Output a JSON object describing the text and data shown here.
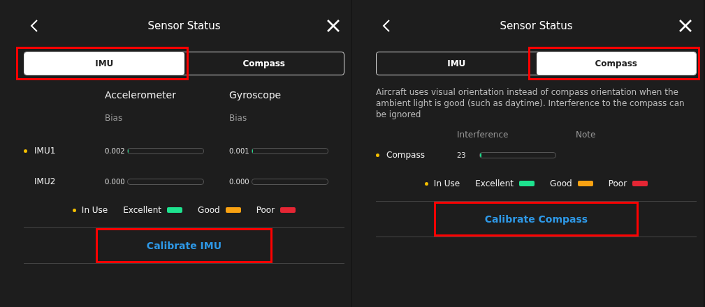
{
  "panels": [
    {
      "title": "Sensor Status",
      "tabs": [
        {
          "label": "IMU",
          "selected": true,
          "highlighted": true
        },
        {
          "label": "Compass",
          "selected": false,
          "highlighted": false
        }
      ],
      "columns": [
        {
          "title": "Accelerometer",
          "subtitle": "Bias"
        },
        {
          "title": "Gyroscope",
          "subtitle": "Bias"
        }
      ],
      "rows": [
        {
          "name": "IMU1",
          "in_use": true,
          "cells": [
            {
              "value": "0.002",
              "level": 0.01
            },
            {
              "value": "0.001",
              "level": 0.01
            }
          ]
        },
        {
          "name": "IMU2",
          "in_use": false,
          "cells": [
            {
              "value": "0.000"
            },
            {
              "value": "0.000"
            }
          ]
        }
      ],
      "legend": {
        "in_use": "In Use",
        "items": [
          {
            "label": "Excellent",
            "color": "#1ee38f"
          },
          {
            "label": "Good",
            "color": "#f9a212"
          },
          {
            "label": "Poor",
            "color": "#e52634"
          }
        ]
      },
      "button": {
        "label": "Calibrate IMU",
        "highlighted": true
      }
    },
    {
      "title": "Sensor Status",
      "tabs": [
        {
          "label": "IMU",
          "selected": false,
          "highlighted": false
        },
        {
          "label": "Compass",
          "selected": true,
          "highlighted": true
        }
      ],
      "note": "Aircraft uses visual orientation instead of compass orientation when the ambient light is good (such as daytime). Interference to the compass can be ignored",
      "columns": [
        {
          "subtitle": "Interference"
        },
        {
          "subtitle": "Note"
        }
      ],
      "rows": [
        {
          "name": "Compass",
          "in_use": true,
          "cells": [
            {
              "value": "23",
              "level": 0.02
            }
          ]
        }
      ],
      "legend": {
        "in_use": "In Use",
        "items": [
          {
            "label": "Excellent",
            "color": "#1ee38f"
          },
          {
            "label": "Good",
            "color": "#f9a212"
          },
          {
            "label": "Poor",
            "color": "#e52634"
          }
        ]
      },
      "button": {
        "label": "Calibrate Compass",
        "highlighted": true
      }
    }
  ]
}
